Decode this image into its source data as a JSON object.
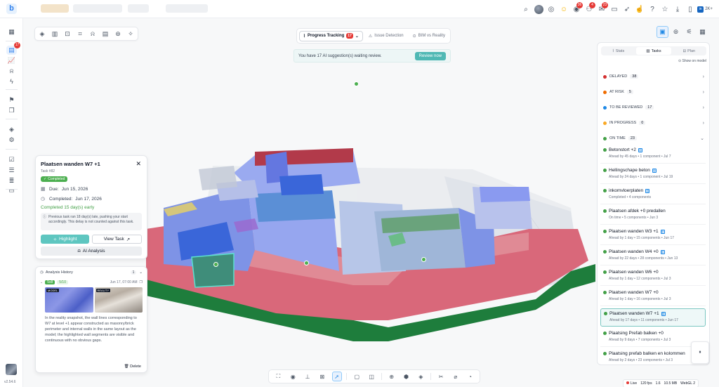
{
  "topbar": {
    "logo": "b",
    "badges": {
      "target": "36",
      "people": "4",
      "mail": "23"
    },
    "linkedin": "2K+"
  },
  "sidebar": {
    "items": [
      "dashboard",
      "progress",
      "chart",
      "robot",
      "lightning",
      "flag",
      "layers-copy",
      "layers",
      "stack-settings",
      "checklist",
      "list",
      "chat"
    ],
    "progress_badge": "17",
    "version": "v2.54.6"
  },
  "viewer": {
    "modes": [
      {
        "label": "Progress Tracking",
        "badge": "17"
      },
      {
        "label": "Issue Detection"
      },
      {
        "label": "BIM vs Reality"
      }
    ],
    "banner": {
      "text": "You have 17 AI suggestion(s) waiting review.",
      "button": "Review now"
    }
  },
  "task_card": {
    "title": "Plaatsen wanden W7 +1",
    "subtitle": "Task #82",
    "status": "Completed",
    "due_label": "Due:",
    "due": "Jun 15, 2026",
    "completed_label": "Completed:",
    "completed": "Jun 17, 2026",
    "early_text": "Completed 15 day(s) early",
    "note": "Previous task ran 18 day(s) late, pushing your start accordingly. This delay is not counted against this task.",
    "highlight": "Highlight",
    "view_task": "View Task",
    "ai_analysis": "AI Analysis"
  },
  "history": {
    "title": "Analysis History",
    "count": "1",
    "tag1": "5x8",
    "tag2": "5/10",
    "date": "Jun 17, 07:00 AM",
    "img_model_tag": "MODEL",
    "img_real_tag": "REALITY",
    "text": "In the reality snapshot, the wall lines corresponding to W7 at level +1 appear constructed as masonry/brick perimeter and internal walls in the same layout as the model; the highlighted wall segments are visible and continuous with no obvious gaps.",
    "delete": "Delete"
  },
  "panel": {
    "tabs": [
      "Stats",
      "Tasks",
      "Plan"
    ],
    "active_tab": "Tasks",
    "show_model": "Show on model",
    "groups": [
      {
        "label": "DELAYED",
        "count": "38",
        "color": "#d32f2f"
      },
      {
        "label": "AT RISK",
        "count": "5",
        "color": "#ef6c00"
      },
      {
        "label": "TO BE REVIEWED",
        "count": "17",
        "color": "#1e88e5"
      },
      {
        "label": "IN PROGRESS",
        "count": "0",
        "color": "#f9a825"
      },
      {
        "label": "ON TIME",
        "count": "23",
        "color": "#43a047"
      }
    ],
    "tasks": [
      {
        "name": "Betonstort +2",
        "meta": "Ahead by 45 days  • 1 component  • Jul 7"
      },
      {
        "name": "Hellingschape beton",
        "meta": "Ahead by 24 days  • 1 component  • Jul 19"
      },
      {
        "name": "inkomvloerplaten",
        "meta": "Completed  • 4 components"
      },
      {
        "name": "Plaatsen afdek +0 predallen",
        "meta": "On time  • 5 components  • Jun 3"
      },
      {
        "name": "Plaatsen wanden W3 +1",
        "meta": "Ahead by 1 day  • 15 components  • Jun 17"
      },
      {
        "name": "Plaatsen wanden W4 +0",
        "meta": "Ahead by 22 days  • 28 components  • Jun 13"
      },
      {
        "name": "Plaatsen wanden W6 +0",
        "meta": "Ahead by 1 day  • 12 components  • Jul 3"
      },
      {
        "name": "Plaatsen wanden W7 +0",
        "meta": "Ahead by 1 day  • 16 components  • Jul 3"
      },
      {
        "name": "Plaatsen wanden W7 +1",
        "meta": "Ahead by 17 days  • 11 components  • Jun 17"
      },
      {
        "name": "Plaatsing Prefab balken +0",
        "meta": "Ahead by 9 days  • 7 components  • Jul 3"
      },
      {
        "name": "Plaatsing prefab balken en kolommen",
        "meta": "Ahead by 2 days  • 23 components  • Jul 3"
      }
    ]
  },
  "status_bar": {
    "live": "Live",
    "fps": "120 fps",
    "scale": "1.6",
    "memory": "10.5 MB",
    "renderer": "WebGL 2"
  }
}
